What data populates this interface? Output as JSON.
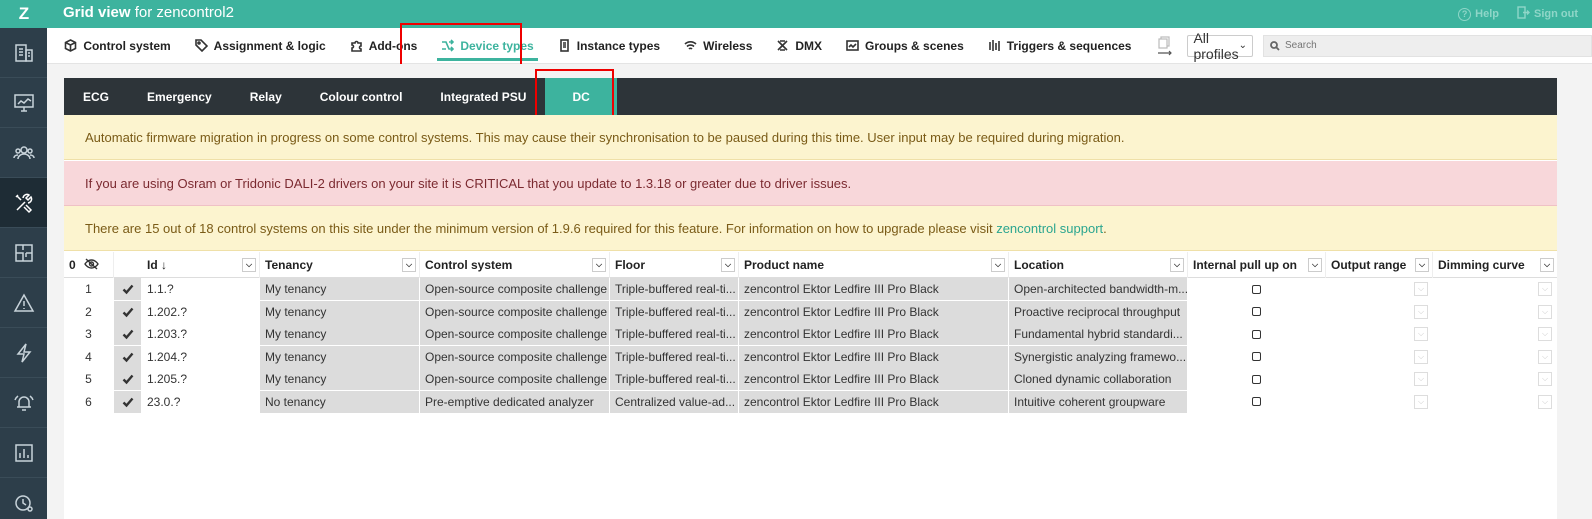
{
  "app": {
    "logo": "Z",
    "title_bold": "Grid view",
    "title_rest": " for zencontrol2",
    "help_label": "Help",
    "signout_label": "Sign out"
  },
  "sidebar": {
    "items": [
      {
        "icon": "building-icon"
      },
      {
        "icon": "monitor-icon"
      },
      {
        "icon": "users-icon"
      },
      {
        "icon": "tools-icon",
        "active": true
      },
      {
        "icon": "floorplan-icon"
      },
      {
        "icon": "warning-icon"
      },
      {
        "icon": "lightning-icon"
      },
      {
        "icon": "alarm-icon"
      },
      {
        "icon": "bar-chart-icon"
      },
      {
        "icon": "clock-settings-icon"
      }
    ]
  },
  "nav": {
    "items": [
      {
        "label": "Control system",
        "icon": "cube-icon"
      },
      {
        "label": "Assignment & logic",
        "icon": "tag-icon"
      },
      {
        "label": "Add-ons",
        "icon": "puzzle-icon"
      },
      {
        "label": "Device types",
        "icon": "shuffle-icon",
        "active": true
      },
      {
        "label": "Instance types",
        "icon": "device-icon"
      },
      {
        "label": "Wireless",
        "icon": "wifi-icon"
      },
      {
        "label": "DMX",
        "icon": "dmx-icon"
      },
      {
        "label": "Groups & scenes",
        "icon": "scene-icon"
      },
      {
        "label": "Triggers & sequences",
        "icon": "bars-icon"
      }
    ],
    "profiles_value": "All profiles",
    "search_placeholder": "Search"
  },
  "subtabs": {
    "items": [
      {
        "label": "ECG"
      },
      {
        "label": "Emergency"
      },
      {
        "label": "Relay"
      },
      {
        "label": "Colour control"
      },
      {
        "label": "Integrated PSU"
      },
      {
        "label": "DC",
        "active": true
      }
    ]
  },
  "alerts": {
    "migration": "Automatic firmware migration in progress on some control systems. This may cause their synchronisation to be paused during this time. User input may be required during migration.",
    "critical": "If you are using Osram or Tridonic DALI-2 drivers on your site it is CRITICAL that you update to 1.3.18 or greater due to driver issues.",
    "version_text": "There are 15 out of 18 control systems on this site under the minimum version of 1.9.6 required for this feature. For information on how to upgrade please visit ",
    "version_link": "zencontrol support",
    "version_end": "."
  },
  "grid": {
    "count": "0",
    "headers": {
      "id": "Id ↓",
      "tenancy": "Tenancy",
      "control_system": "Control system",
      "floor": "Floor",
      "product_name": "Product name",
      "location": "Location",
      "internal_pull_up": "Internal pull up on",
      "output_range": "Output range",
      "dimming_curve": "Dimming curve"
    },
    "rows": [
      {
        "n": "1",
        "id": "1.1.?",
        "tenancy": "My tenancy",
        "control_system": "Open-source composite challenge",
        "floor": "Triple-buffered real-ti...",
        "product": "zencontrol Ektor Ledfire III Pro Black",
        "location": "Open-architected bandwidth-m..."
      },
      {
        "n": "2",
        "id": "1.202.?",
        "tenancy": "My tenancy",
        "control_system": "Open-source composite challenge",
        "floor": "Triple-buffered real-ti...",
        "product": "zencontrol Ektor Ledfire III Pro Black",
        "location": "Proactive reciprocal throughput"
      },
      {
        "n": "3",
        "id": "1.203.?",
        "tenancy": "My tenancy",
        "control_system": "Open-source composite challenge",
        "floor": "Triple-buffered real-ti...",
        "product": "zencontrol Ektor Ledfire III Pro Black",
        "location": "Fundamental hybrid standardi..."
      },
      {
        "n": "4",
        "id": "1.204.?",
        "tenancy": "My tenancy",
        "control_system": "Open-source composite challenge",
        "floor": "Triple-buffered real-ti...",
        "product": "zencontrol Ektor Ledfire III Pro Black",
        "location": "Synergistic analyzing framewo..."
      },
      {
        "n": "5",
        "id": "1.205.?",
        "tenancy": "My tenancy",
        "control_system": "Open-source composite challenge",
        "floor": "Triple-buffered real-ti...",
        "product": "zencontrol Ektor Ledfire III Pro Black",
        "location": "Cloned dynamic collaboration"
      },
      {
        "n": "6",
        "id": "23.0.?",
        "tenancy": "No tenancy",
        "control_system": "Pre-emptive dedicated analyzer",
        "floor": "Centralized value-ad...",
        "product": "zencontrol Ektor Ledfire III Pro Black",
        "location": "Intuitive coherent groupware"
      }
    ]
  },
  "colors": {
    "brand": "#3db39e",
    "sidebar": "#2d3e4a",
    "subtab_bar": "#2d3439",
    "highlight": "#ee0000"
  }
}
